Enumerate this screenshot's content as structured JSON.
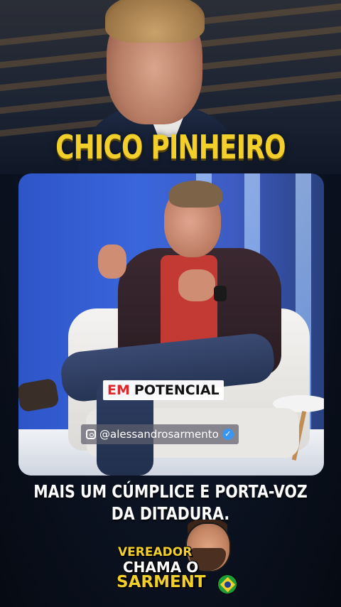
{
  "header": {
    "title": "CHICO PINHEIRO"
  },
  "video": {
    "subtitle_highlight": "EM",
    "subtitle_text": "POTENCIAL",
    "watermark_handle": "@alessandrosarmento",
    "watermark_icon": "instagram-icon",
    "verified_icon": "verified-badge-icon"
  },
  "caption": {
    "line1": "MAIS UM CÚMPLICE E PORTA-VOZ",
    "line2": "DA DITADURA."
  },
  "brand": {
    "line1": "VEREADOR",
    "line2": "CHAMA O",
    "line3": "SARMENT",
    "flag_icon": "brazil-flag-icon"
  },
  "colors": {
    "title_yellow": "#f2cf2a",
    "subtitle_red": "#e0262b",
    "background_navy": "#0c1322"
  }
}
